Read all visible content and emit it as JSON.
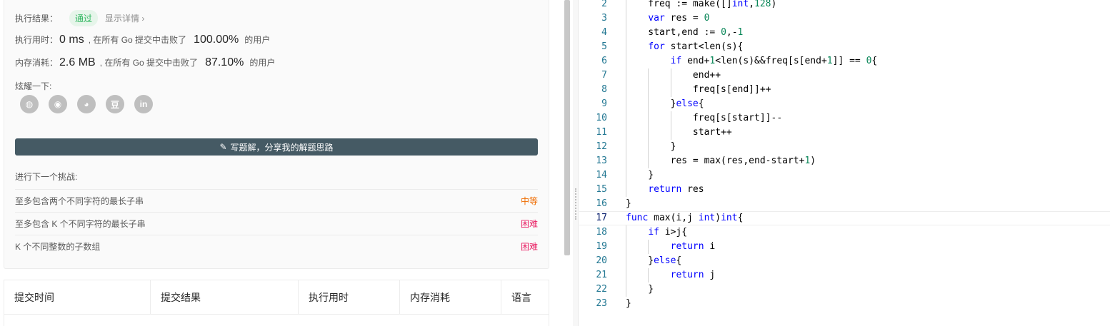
{
  "result": {
    "label": "执行结果：",
    "status": "通过",
    "details_link": "显示详情 ›"
  },
  "time": {
    "label": "执行用时：",
    "value": "0 ms",
    "mid_text": ", 在所有 Go 提交中击败了",
    "percent": "100.00%",
    "tail": "的用户"
  },
  "memory": {
    "label": "内存消耗：",
    "value": "2.6 MB",
    "mid_text": ", 在所有 Go 提交中击败了",
    "percent": "87.10%",
    "tail": "的用户"
  },
  "share": {
    "label": "炫耀一下:",
    "icons": [
      {
        "name": "wechat-icon",
        "glyph": "◍"
      },
      {
        "name": "weibo-icon",
        "glyph": "◉"
      },
      {
        "name": "qq-icon",
        "glyph": "◕"
      },
      {
        "name": "douban-icon",
        "glyph": "豆"
      },
      {
        "name": "linkedin-icon",
        "glyph": "in"
      }
    ]
  },
  "write_button": {
    "icon": "pencil-icon",
    "label": "写题解，分享我的解题思路"
  },
  "next_challenge": {
    "label": "进行下一个挑战:",
    "items": [
      {
        "title": "至多包含两个不同字符的最长子串",
        "difficulty": "中等"
      },
      {
        "title": "至多包含 K 个不同字符的最长子串",
        "difficulty": "困难"
      },
      {
        "title": "K 个不同整数的子数组",
        "difficulty": "困难"
      }
    ]
  },
  "submissions_table": {
    "headers": [
      "提交时间",
      "提交结果",
      "执行用时",
      "内存消耗",
      "语言"
    ]
  },
  "colors": {
    "pass_green": "#2db55d",
    "medium_orange": "#ef6c00",
    "hard_pink": "#e91e63",
    "button_dark": "#455a64",
    "keyword_blue": "#0000ff",
    "number_green": "#098658",
    "line_number": "#237893"
  },
  "editor": {
    "active_line": "17",
    "lines": [
      {
        "n": "2",
        "tokens": [
          [
            "    freq := make([]",
            ""
          ],
          [
            "int",
            "kw"
          ],
          [
            ",",
            ""
          ],
          [
            "128",
            "num"
          ],
          [
            ")",
            ""
          ]
        ]
      },
      {
        "n": "3",
        "tokens": [
          [
            "    ",
            ""
          ],
          [
            "var",
            "kw"
          ],
          [
            " res = ",
            ""
          ],
          [
            "0",
            "num"
          ]
        ]
      },
      {
        "n": "4",
        "tokens": [
          [
            "    start,end := ",
            ""
          ],
          [
            "0",
            "num"
          ],
          [
            ",-",
            ""
          ],
          [
            "1",
            "num"
          ]
        ]
      },
      {
        "n": "5",
        "tokens": [
          [
            "    ",
            ""
          ],
          [
            "for",
            "kw"
          ],
          [
            " start<len(s){",
            ""
          ]
        ]
      },
      {
        "n": "6",
        "tokens": [
          [
            "        ",
            ""
          ],
          [
            "if",
            "kw"
          ],
          [
            " end+",
            ""
          ],
          [
            "1",
            "num"
          ],
          [
            "<len(s)&&freq[s[end+",
            ""
          ],
          [
            "1",
            "num"
          ],
          [
            "]] == ",
            ""
          ],
          [
            "0",
            "num"
          ],
          [
            "{",
            ""
          ]
        ]
      },
      {
        "n": "7",
        "tokens": [
          [
            "            end++",
            ""
          ]
        ]
      },
      {
        "n": "8",
        "tokens": [
          [
            "            freq[s[end]]++",
            ""
          ]
        ]
      },
      {
        "n": "9",
        "tokens": [
          [
            "        }",
            ""
          ],
          [
            "else",
            "kw"
          ],
          [
            "{",
            ""
          ]
        ]
      },
      {
        "n": "10",
        "tokens": [
          [
            "            freq[s[start]]--",
            ""
          ]
        ]
      },
      {
        "n": "11",
        "tokens": [
          [
            "            start++",
            ""
          ]
        ]
      },
      {
        "n": "12",
        "tokens": [
          [
            "        }",
            ""
          ]
        ]
      },
      {
        "n": "13",
        "tokens": [
          [
            "        res = max(res,end-start+",
            ""
          ],
          [
            "1",
            "num"
          ],
          [
            ")",
            ""
          ]
        ]
      },
      {
        "n": "14",
        "tokens": [
          [
            "    }",
            ""
          ]
        ]
      },
      {
        "n": "15",
        "tokens": [
          [
            "    ",
            ""
          ],
          [
            "return",
            "kw"
          ],
          [
            " res",
            ""
          ]
        ]
      },
      {
        "n": "16",
        "tokens": [
          [
            "}",
            ""
          ]
        ]
      },
      {
        "n": "17",
        "tokens": [
          [
            "func",
            "kw"
          ],
          [
            " max(i,j ",
            ""
          ],
          [
            "int",
            "kw"
          ],
          [
            ")",
            ""
          ],
          [
            "int",
            "kw"
          ],
          [
            "{",
            ""
          ]
        ]
      },
      {
        "n": "18",
        "tokens": [
          [
            "    ",
            ""
          ],
          [
            "if",
            "kw"
          ],
          [
            " i>j{",
            ""
          ]
        ]
      },
      {
        "n": "19",
        "tokens": [
          [
            "        ",
            ""
          ],
          [
            "return",
            "kw"
          ],
          [
            " i",
            ""
          ]
        ]
      },
      {
        "n": "20",
        "tokens": [
          [
            "    }",
            ""
          ],
          [
            "else",
            "kw"
          ],
          [
            "{",
            ""
          ]
        ]
      },
      {
        "n": "21",
        "tokens": [
          [
            "        ",
            ""
          ],
          [
            "return",
            "kw"
          ],
          [
            " j",
            ""
          ]
        ]
      },
      {
        "n": "22",
        "tokens": [
          [
            "    }",
            ""
          ]
        ]
      },
      {
        "n": "23",
        "tokens": [
          [
            "}",
            ""
          ]
        ]
      }
    ]
  }
}
